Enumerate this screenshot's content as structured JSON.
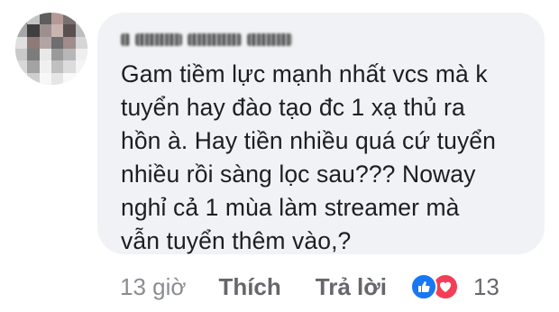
{
  "comment": {
    "avatar_colors": [
      "#8a8a8a",
      "#c4c4c4",
      "#5d5d5d",
      "#b39a96",
      "#7a6f70",
      "#d0d0d0",
      "#a8a8a8",
      "#3f3f3f",
      "#9c8f8d",
      "#c8b5b0",
      "#5a5050",
      "#bdbdbd",
      "#e0e0e0",
      "#8f7a78",
      "#b0a5a3",
      "#6e6e6e",
      "#a08c8a",
      "#d6d6d6",
      "#c9c9c9",
      "#7c7c7c",
      "#e8e8e8",
      "#9a9a9a",
      "#b7b7b7",
      "#efefef",
      "#d9d9d9",
      "#a3a3a3",
      "#f0f0f0",
      "#c0c0c0",
      "#dcdcdc",
      "#f5f5f5",
      "#eeeeee",
      "#cfcfcf",
      "#f7f7f7",
      "#e6e6e6",
      "#f9f9f9",
      "#ffffff"
    ],
    "text": "Gam tiềm lực mạnh nhất vcs mà k\ntuyển hay đào tạo đc 1 xạ thủ ra\nhồn à. Hay tiền nhiều quá cứ tuyển\nnhiều rồi sàng lọc sau??? Noway\nnghỉ cả 1 mùa làm streamer mà\nvẫn tuyển thêm vào,?"
  },
  "actions": {
    "time": "13 giờ",
    "like_label": "Thích",
    "reply_label": "Trả lời",
    "reactions": [
      "like-icon",
      "love-icon"
    ],
    "reaction_count": "13",
    "colors": {
      "like": "#1877f2",
      "love": "#f33e58",
      "muted": "#65676b"
    }
  }
}
